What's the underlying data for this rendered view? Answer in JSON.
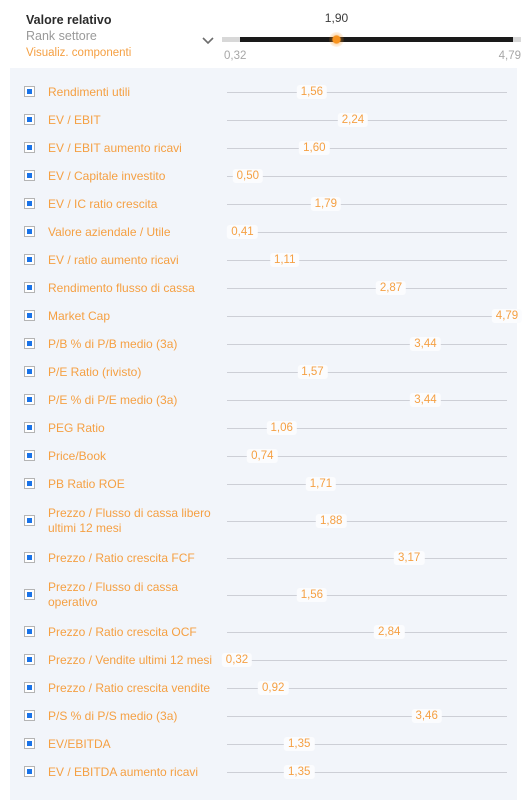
{
  "header": {
    "title": "Valore relativo",
    "subtitle": "Rank settore",
    "link": "Visualiz. componenti",
    "chevron_icon": "chevron-down-icon",
    "slider": {
      "value_label": "1,90",
      "value": 1.9,
      "min_label": "0,32",
      "max_label": "4,79",
      "min": 0.32,
      "max": 4.79,
      "thumb_color": "#f7931e",
      "fill_color": "#1a1a1a",
      "track_color": "#d8d8d8"
    }
  },
  "colors": {
    "accent": "#f5a043",
    "checkbox_fill": "#1a73e8",
    "panel_bg": "#f2f5fa",
    "line": "#cdcfd6"
  },
  "chart_data": {
    "type": "bar",
    "title": "Valore relativo",
    "xlabel": "",
    "ylabel": "",
    "xlim": [
      0.32,
      4.79
    ],
    "grid": false,
    "legend": "none",
    "axis_min_label": "0,32",
    "axis_max_label": "4,79",
    "categories": [
      "Rendimenti utili",
      "EV / EBIT",
      "EV / EBIT aumento ricavi",
      "EV / Capitale investito",
      "EV / IC ratio crescita",
      "Valore aziendale / Utile",
      "EV / ratio aumento ricavi",
      "Rendimento flusso di cassa",
      "Market Cap",
      "P/B % di P/B medio (3a)",
      "P/E Ratio (rivisto)",
      "P/E % di P/E medio (3a)",
      "PEG Ratio",
      "Price/Book",
      "PB Ratio ROE",
      "Prezzo / Flusso di cassa libero ultimi 12 mesi",
      "Prezzo / Ratio crescita FCF",
      "Prezzo / Flusso di cassa operativo",
      "Prezzo / Ratio crescita OCF",
      "Prezzo / Vendite ultimi 12 mesi",
      "Prezzo / Ratio crescita vendite",
      "P/S % di P/S medio (3a)",
      "EV/EBITDA",
      "EV / EBITDA aumento ricavi"
    ],
    "values": [
      1.56,
      2.24,
      1.6,
      0.5,
      1.79,
      0.41,
      1.11,
      2.87,
      4.79,
      3.44,
      1.57,
      3.44,
      1.06,
      0.74,
      1.71,
      1.88,
      3.17,
      1.56,
      2.84,
      0.32,
      0.92,
      3.46,
      1.35,
      1.35
    ],
    "value_labels": [
      "1,56",
      "2,24",
      "1,60",
      "0,50",
      "1,79",
      "0,41",
      "1,11",
      "2,87",
      "4,79",
      "3,44",
      "1,57",
      "3,44",
      "1,06",
      "0,74",
      "1,71",
      "1,88",
      "3,17",
      "1,56",
      "2,84",
      "0,32",
      "0,92",
      "3,46",
      "1,35",
      "1,35"
    ]
  },
  "rows": [
    {
      "label": "Rendimenti utili",
      "value_label": "1,56",
      "value": 1.56,
      "two_line": false,
      "checked": true
    },
    {
      "label": "EV / EBIT",
      "value_label": "2,24",
      "value": 2.24,
      "two_line": false,
      "checked": true
    },
    {
      "label": "EV / EBIT aumento ricavi",
      "value_label": "1,60",
      "value": 1.6,
      "two_line": false,
      "checked": true
    },
    {
      "label": "EV / Capitale investito",
      "value_label": "0,50",
      "value": 0.5,
      "two_line": false,
      "checked": true
    },
    {
      "label": "EV / IC ratio crescita",
      "value_label": "1,79",
      "value": 1.79,
      "two_line": false,
      "checked": true
    },
    {
      "label": "Valore aziendale / Utile",
      "value_label": "0,41",
      "value": 0.41,
      "two_line": false,
      "checked": true
    },
    {
      "label": "EV / ratio aumento ricavi",
      "value_label": "1,11",
      "value": 1.11,
      "two_line": false,
      "checked": true
    },
    {
      "label": "Rendimento flusso di cassa",
      "value_label": "2,87",
      "value": 2.87,
      "two_line": false,
      "checked": true
    },
    {
      "label": "Market Cap",
      "value_label": "4,79",
      "value": 4.79,
      "two_line": false,
      "checked": true
    },
    {
      "label": "P/B % di P/B medio (3a)",
      "value_label": "3,44",
      "value": 3.44,
      "two_line": false,
      "checked": true
    },
    {
      "label": "P/E Ratio (rivisto)",
      "value_label": "1,57",
      "value": 1.57,
      "two_line": false,
      "checked": true
    },
    {
      "label": "P/E % di P/E medio (3a)",
      "value_label": "3,44",
      "value": 3.44,
      "two_line": false,
      "checked": true
    },
    {
      "label": "PEG Ratio",
      "value_label": "1,06",
      "value": 1.06,
      "two_line": false,
      "checked": true
    },
    {
      "label": "Price/Book",
      "value_label": "0,74",
      "value": 0.74,
      "two_line": false,
      "checked": true
    },
    {
      "label": "PB Ratio ROE",
      "value_label": "1,71",
      "value": 1.71,
      "two_line": false,
      "checked": true
    },
    {
      "label": "Prezzo / Flusso di cassa libero ultimi 12 mesi",
      "value_label": "1,88",
      "value": 1.88,
      "two_line": true,
      "checked": true
    },
    {
      "label": "Prezzo / Ratio crescita FCF",
      "value_label": "3,17",
      "value": 3.17,
      "two_line": false,
      "checked": true
    },
    {
      "label": "Prezzo / Flusso di cassa operativo",
      "value_label": "1,56",
      "value": 1.56,
      "two_line": true,
      "checked": true
    },
    {
      "label": "Prezzo / Ratio crescita OCF",
      "value_label": "2,84",
      "value": 2.84,
      "two_line": false,
      "checked": true
    },
    {
      "label": "Prezzo / Vendite ultimi 12 mesi",
      "value_label": "0,32",
      "value": 0.32,
      "two_line": false,
      "checked": true
    },
    {
      "label": "Prezzo / Ratio crescita vendite",
      "value_label": "0,92",
      "value": 0.92,
      "two_line": false,
      "checked": true
    },
    {
      "label": "P/S % di P/S medio (3a)",
      "value_label": "3,46",
      "value": 3.46,
      "two_line": false,
      "checked": true
    },
    {
      "label": "EV/EBITDA",
      "value_label": "1,35",
      "value": 1.35,
      "two_line": false,
      "checked": true
    },
    {
      "label": "EV / EBITDA aumento ricavi",
      "value_label": "1,35",
      "value": 1.35,
      "two_line": false,
      "checked": true
    }
  ]
}
